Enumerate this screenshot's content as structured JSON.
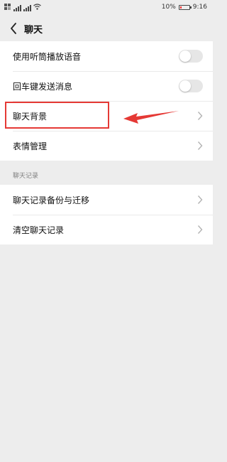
{
  "status_bar": {
    "network_left": "",
    "network_mid": "4G",
    "battery": "10%",
    "time": "9:16"
  },
  "header": {
    "back_icon": "chevron-left",
    "title": "聊天"
  },
  "settings": {
    "toggles": [
      {
        "label": "使用听筒播放语音",
        "on": false
      },
      {
        "label": "回车键发送消息",
        "on": false
      }
    ],
    "links": [
      {
        "label": "聊天背景"
      },
      {
        "label": "表情管理"
      }
    ]
  },
  "history_section": {
    "label": "聊天记录",
    "items": [
      {
        "label": "聊天记录备份与迁移"
      },
      {
        "label": "清空聊天记录"
      }
    ]
  },
  "annotation": {
    "highlight_color": "#e53935",
    "target": "聊天背景"
  }
}
